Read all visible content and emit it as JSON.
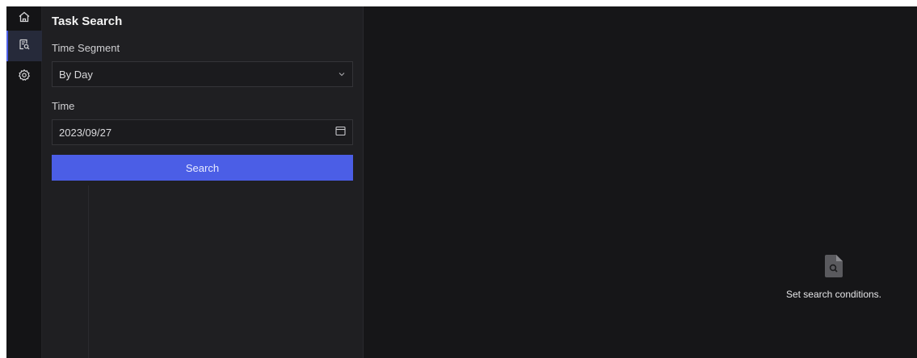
{
  "nav": {
    "items": [
      {
        "name": "home",
        "icon": "home-icon",
        "active": false
      },
      {
        "name": "task-search",
        "icon": "task-search-icon",
        "active": true
      },
      {
        "name": "settings",
        "icon": "gear-icon",
        "active": false
      }
    ]
  },
  "panel": {
    "title": "Task Search",
    "time_segment": {
      "label": "Time Segment",
      "value": "By Day",
      "icon": "chevron-down-icon"
    },
    "time": {
      "label": "Time",
      "value": "2023/09/27",
      "icon": "calendar-icon"
    },
    "search_button": "Search"
  },
  "main": {
    "empty_icon": "search-file-icon",
    "empty_text": "Set search conditions."
  },
  "colors": {
    "accent": "#4b5ee6",
    "background": "#1c1c1e",
    "panel": "#1f1f22",
    "main": "#161618"
  }
}
